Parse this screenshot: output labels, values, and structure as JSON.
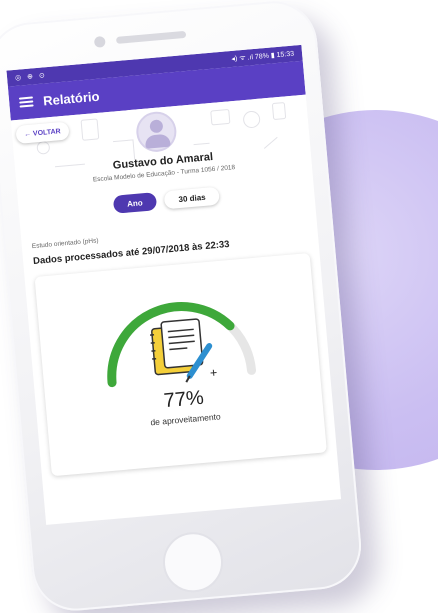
{
  "status_bar": {
    "left_icons": "◎ ⊕ ⊙",
    "right_text": "◂) ᯤ .ıl 78% ▮ 15:33"
  },
  "app_bar": {
    "title": "Relatório"
  },
  "header": {
    "back_label": "← VOLTAR",
    "student_name": "Gustavo do Amaral",
    "school": "Escola Modelo de Educação - Turma 1056 / 2018"
  },
  "period_toggle": {
    "options": [
      "Ano",
      "30 dias"
    ],
    "selected": "Ano"
  },
  "section": {
    "label": "Estudo orientado (pHs)",
    "processed": "Dados processados até 29/07/2018 às 22:33"
  },
  "performance": {
    "percent_label": "77%",
    "value": 0.77,
    "caption": "de aproveitamento"
  },
  "colors": {
    "primary": "#5a40c4",
    "primary_dark": "#4e38b0",
    "gauge": "#3ea83a",
    "gauge_track": "#e6e6e6",
    "background_circle": "#cbbff2"
  },
  "icons": [
    "menu-icon",
    "back-arrow-icon",
    "avatar-icon",
    "notebook-pen-icon"
  ]
}
